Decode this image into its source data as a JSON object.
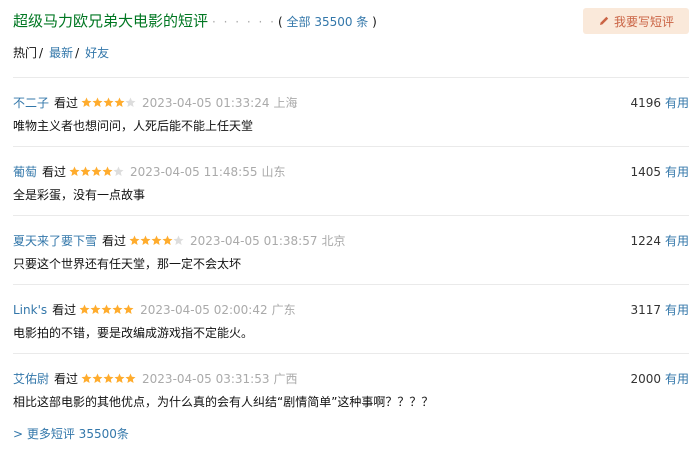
{
  "header": {
    "title": "超级马力欧兄弟大电影的短评",
    "dots": "· · · · · ·",
    "count_open": "(",
    "count_link": "全部 35500 条",
    "count_close": ")",
    "write_button": "我要写短评"
  },
  "tabs": [
    {
      "label": "热门",
      "sep": "/"
    },
    {
      "label": "最新",
      "sep": "/"
    },
    {
      "label": "好友",
      "sep": ""
    }
  ],
  "reviews": [
    {
      "user": "不二子",
      "watched": "看过",
      "rating": 4,
      "time": "2023-04-05 01:33:24",
      "location": "上海",
      "votes": "4196",
      "useful": "有用",
      "text": "唯物主义者也想问问，人死后能不能上任天堂"
    },
    {
      "user": "葡萄",
      "watched": "看过",
      "rating": 4,
      "time": "2023-04-05 11:48:55",
      "location": "山东",
      "votes": "1405",
      "useful": "有用",
      "text": "全是彩蛋，没有一点故事"
    },
    {
      "user": "夏天来了要下雪",
      "watched": "看过",
      "rating": 4,
      "time": "2023-04-05 01:38:57",
      "location": "北京",
      "votes": "1224",
      "useful": "有用",
      "text": "只要这个世界还有任天堂，那一定不会太坏"
    },
    {
      "user": "Link's",
      "watched": "看过",
      "rating": 5,
      "time": "2023-04-05 02:00:42",
      "location": "广东",
      "votes": "3117",
      "useful": "有用",
      "text": "电影拍的不错，要是改编成游戏指不定能火。"
    },
    {
      "user": "艾佑尉",
      "watched": "看过",
      "rating": 5,
      "time": "2023-04-05 03:31:53",
      "location": "广西",
      "votes": "2000",
      "useful": "有用",
      "text": "相比这部电影的其他优点，为什么真的会有人纠结“剧情简单”这种事啊？？？？"
    }
  ],
  "more_link": "> 更多短评 35500条",
  "colors": {
    "title_green": "#007722",
    "link_blue": "#3377aa",
    "star_filled": "#ffac2d",
    "star_empty": "#dddddd",
    "button_bg": "#fae9da",
    "button_text": "#ca6445"
  },
  "icons": {
    "write": "pen-icon",
    "rating": "star-icon"
  }
}
